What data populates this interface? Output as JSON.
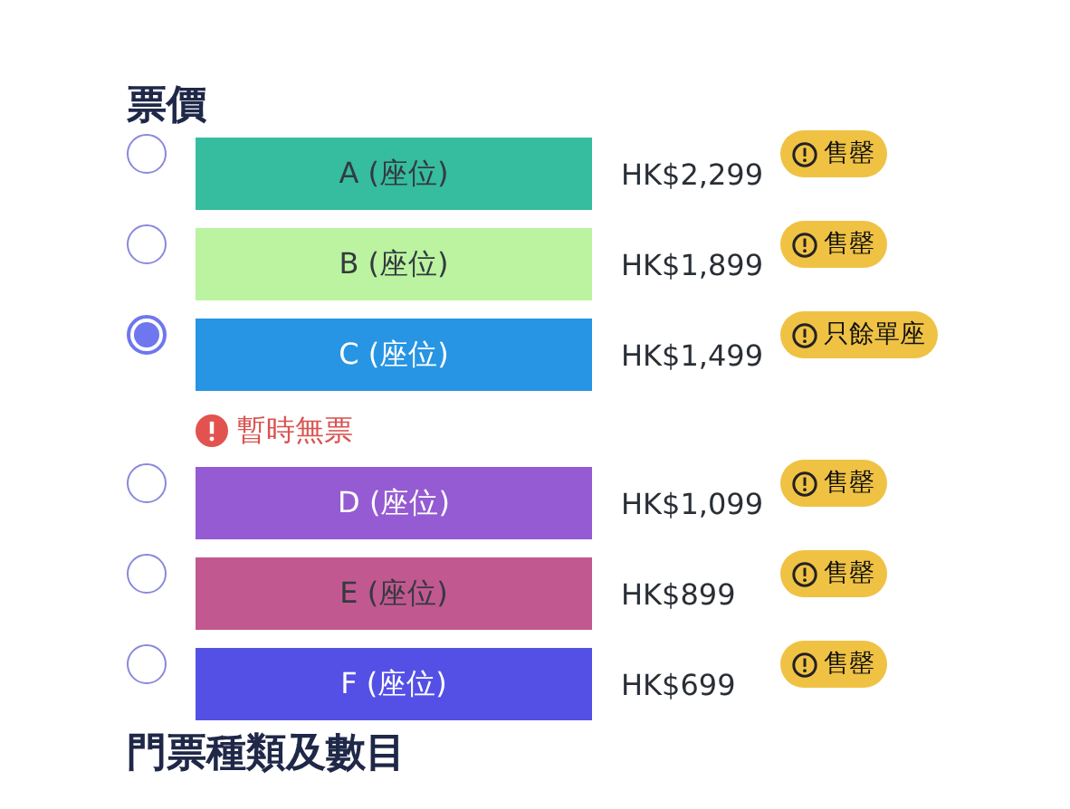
{
  "price_section": {
    "title": "票價",
    "options": [
      {
        "label": "A (座位)",
        "color": "#36bc9f",
        "dark_label": true,
        "price": "HK$2,299",
        "badge": "售罄",
        "selected": false
      },
      {
        "label": "B (座位)",
        "color": "#bbf3a0",
        "dark_label": true,
        "price": "HK$1,899",
        "badge": "售罄",
        "selected": false
      },
      {
        "label": "C (座位)",
        "color": "#2795e3",
        "dark_label": false,
        "price": "HK$1,499",
        "badge": "只餘單座",
        "selected": true,
        "warning": "暫時無票"
      },
      {
        "label": "D (座位)",
        "color": "#955bd2",
        "dark_label": false,
        "price": "HK$1,099",
        "badge": "售罄",
        "selected": false
      },
      {
        "label": "E (座位)",
        "color": "#c25890",
        "dark_label": true,
        "price": "HK$899",
        "badge": "售罄",
        "selected": false
      },
      {
        "label": "F (座位)",
        "color": "#5450e6",
        "dark_label": false,
        "price": "HK$699",
        "badge": "售罄",
        "selected": false
      }
    ]
  },
  "ticket_section": {
    "title": "門票種類及數目"
  }
}
